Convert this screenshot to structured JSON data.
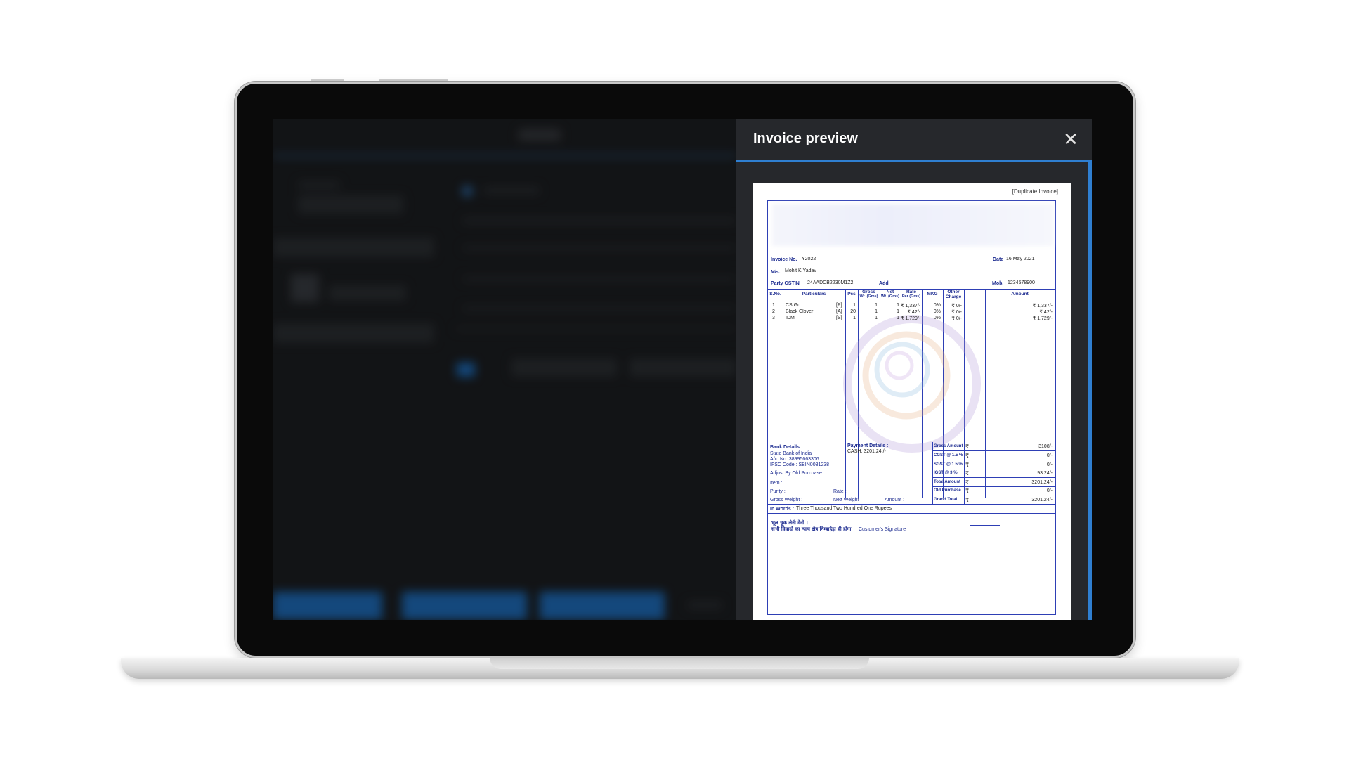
{
  "panel": {
    "title": "Invoice preview",
    "close_icon": "close-icon"
  },
  "invoice": {
    "copy_label": "[Duplicate Invoice]",
    "invoice_no_label": "Invoice No.",
    "invoice_no": "Y2022",
    "date_label": "Date",
    "date": "16 May 2021",
    "ms_label": "M/s.",
    "customer": "Mohit K Yadav",
    "gstin_label": "Party GSTIN",
    "gstin": "24AADCB2230M1Z2",
    "add_label": "Add",
    "mob_label": "Mob.",
    "mob": "1234578900",
    "columns": {
      "sno": "S.No.",
      "particulars": "Particulars",
      "pcs": "Pcs",
      "gross_1": "Gross",
      "gross_2": "Wt. (Gms)",
      "net_1": "Net",
      "net_2": "Wt. (Gms)",
      "rate_1": "Rate",
      "rate_2": "Per (Gms)",
      "mkg": "MKG",
      "other_1": "Other",
      "other_2": "Charge",
      "amount": "Amount"
    },
    "items": [
      {
        "sno": "1",
        "name": "CS Go",
        "tag": "[P]",
        "pcs": "1",
        "gross": "1",
        "net": "1",
        "rate": "₹ 1,337/-",
        "mkg": "0%",
        "other": "₹ 0/-",
        "amount": "₹ 1,337/-"
      },
      {
        "sno": "2",
        "name": "Black Clover",
        "tag": "[A]",
        "pcs": "20",
        "gross": "1",
        "net": "1",
        "rate": "₹ 42/-",
        "mkg": "0%",
        "other": "₹ 0/-",
        "amount": "₹ 42/-"
      },
      {
        "sno": "3",
        "name": "IDM",
        "tag": "[S]",
        "pcs": "1",
        "gross": "1",
        "net": "1",
        "rate": "₹ 1,729/-",
        "mkg": "0%",
        "other": "₹ 0/-",
        "amount": "₹ 1,729/-"
      }
    ],
    "bank": {
      "heading": "Bank Details :",
      "name": "State Bank of India",
      "account": "A/c. No. 38995663306",
      "ifsc": "IFSC Code : SBIN0031238"
    },
    "payment": {
      "heading": "Payment Details :",
      "line": "CASH: 3201.24 /-"
    },
    "old_purchase": {
      "heading": "Adjust By Old Purchase",
      "item": "Item :",
      "purity": "Purity :",
      "rate": "Rate :",
      "gross_weight": "Gross Weight :",
      "nett_weight": "Nett Weight :",
      "amount": "Amount :"
    },
    "totals": [
      {
        "label": "Gross Amount",
        "value": "3108/-"
      },
      {
        "label": "CGST @ 1.5 %",
        "value": "0/-"
      },
      {
        "label": "SGST @ 1.5 %",
        "value": "0/-"
      },
      {
        "label": "IGST @ 3 %",
        "value": "93.24/-"
      },
      {
        "label": "Total Amount",
        "value": "3201.24/-"
      },
      {
        "label": "Old Purchase",
        "value": "0/-"
      },
      {
        "label": "Grand Total",
        "value": "3201.24/-"
      }
    ],
    "currency_symbol": "₹",
    "in_words_label": "In Words :",
    "in_words": "Three Thousand Two Hundred One Rupees",
    "hindi_line_1": "भूल चूक लेनी देनी ।",
    "hindi_line_2": "सभी विवादों का न्याय क्षेत्र निम्बाहेड़ा ही होगा ।",
    "customer_signature": "Customer's Signature"
  }
}
